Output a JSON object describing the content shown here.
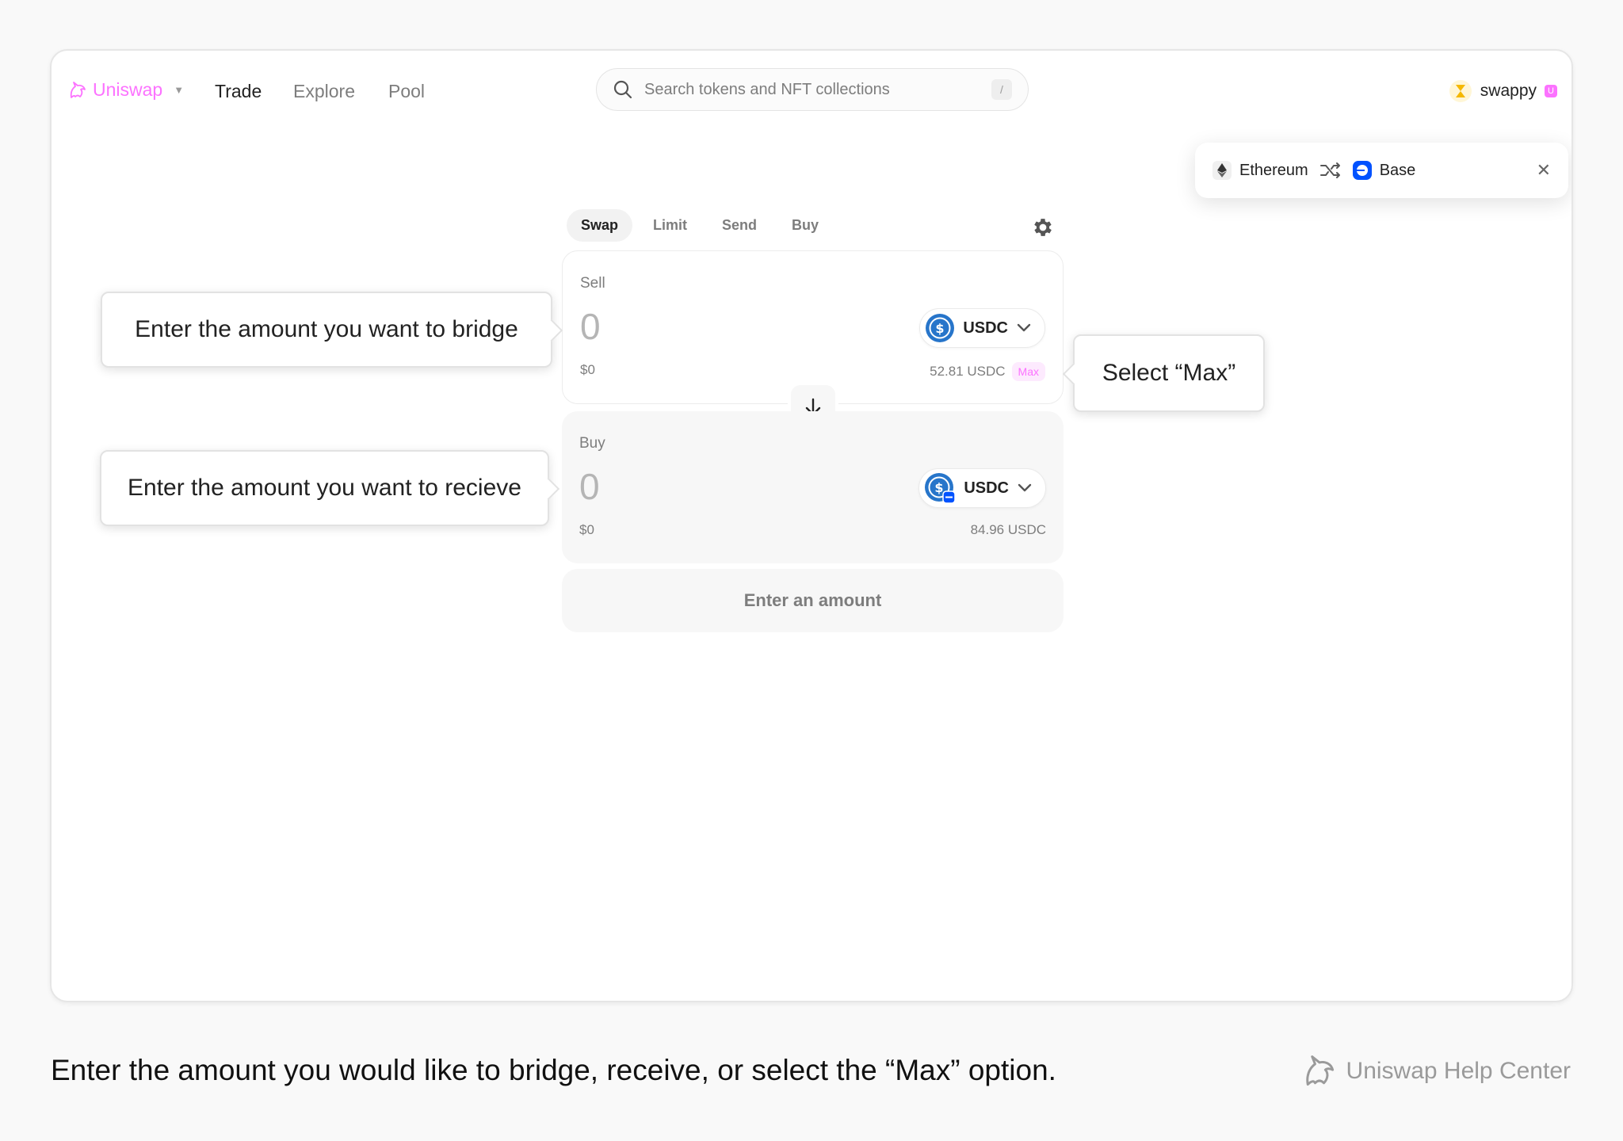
{
  "nav": {
    "brand": "Uniswap",
    "links": [
      "Trade",
      "Explore",
      "Pool"
    ],
    "search_placeholder": "Search tokens and NFT collections",
    "search_shortcut": "/",
    "account_name": "swappy"
  },
  "bridge": {
    "from_chain": "Ethereum",
    "to_chain": "Base"
  },
  "tabs": [
    "Swap",
    "Limit",
    "Send",
    "Buy"
  ],
  "sell": {
    "label": "Sell",
    "amount": "0",
    "usd_value": "$0",
    "token": "USDC",
    "balance": "52.81 USDC",
    "max_label": "Max"
  },
  "buy": {
    "label": "Buy",
    "amount": "0",
    "usd_value": "$0",
    "token": "USDC",
    "balance": "84.96 USDC"
  },
  "cta_label": "Enter an amount",
  "callouts": {
    "sell": "Enter the amount you want to bridge",
    "buy": "Enter the amount you want to recieve",
    "max": "Select “Max”"
  },
  "footer": {
    "caption": "Enter the amount you would like to bridge, receive, or select the “Max” option.",
    "help_center": "Uniswap Help Center"
  },
  "colors": {
    "brand_pink": "#fc72ff",
    "usdc_blue": "#2775ca",
    "base_blue": "#0052ff"
  }
}
